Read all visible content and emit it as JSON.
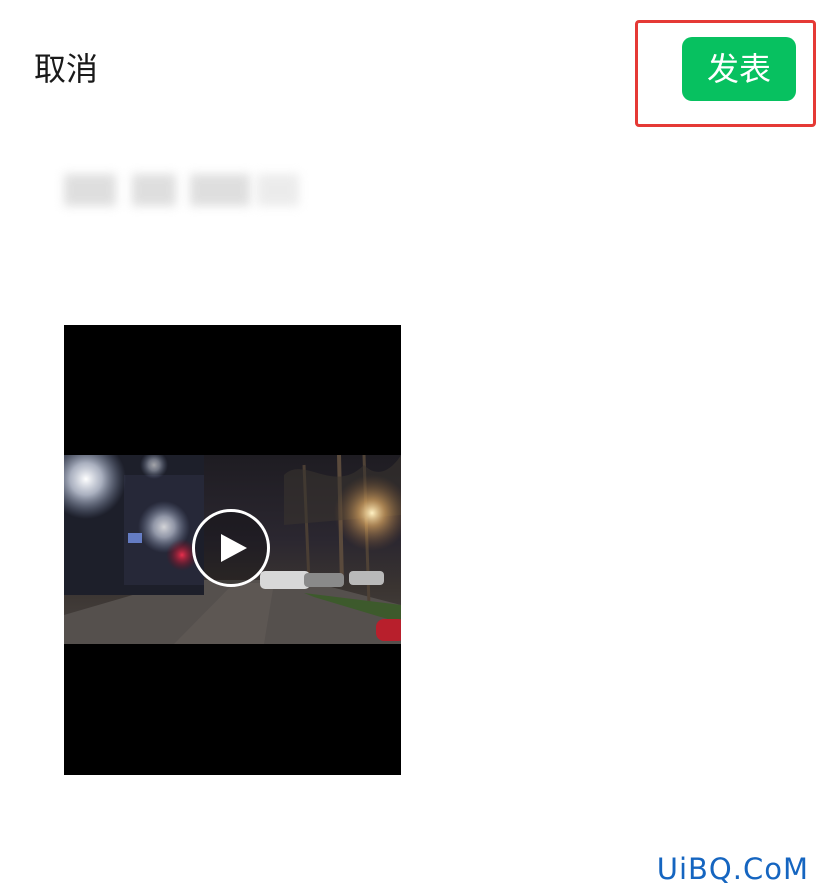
{
  "header": {
    "cancel_label": "取消",
    "publish_label": "发表"
  },
  "watermark": "UiBQ.CoM",
  "colors": {
    "publish_button": "#07c160",
    "highlight_border": "#e53935",
    "watermark": "#1565c0"
  },
  "icons": {
    "play": "play-icon"
  }
}
